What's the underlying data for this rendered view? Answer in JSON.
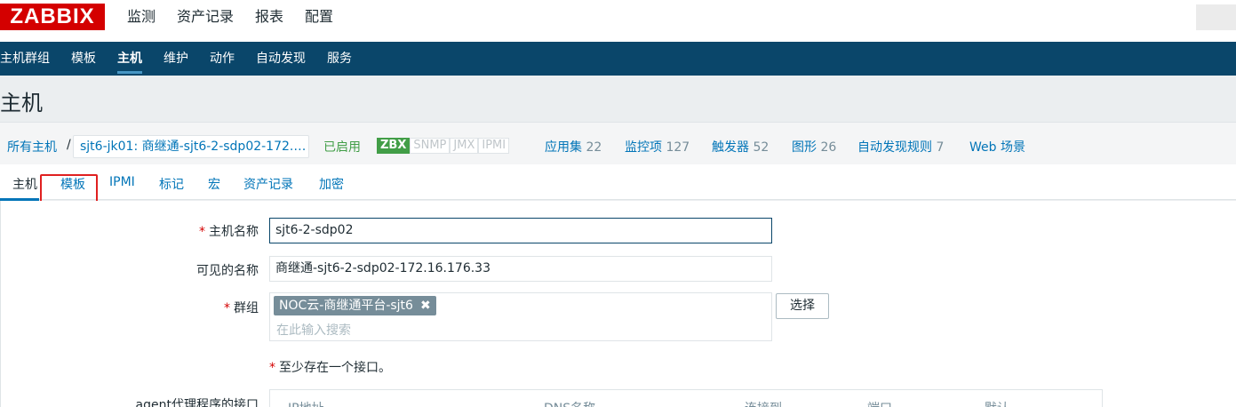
{
  "header": {
    "logo": "ZABBIX",
    "menu": [
      "监测",
      "资产记录",
      "报表",
      "配置"
    ]
  },
  "subnav": [
    "主机群组",
    "模板",
    "主机",
    "维护",
    "动作",
    "自动发现",
    "服务"
  ],
  "page_title": "主机",
  "breadcrumb": {
    "all_hosts": "所有主机",
    "separator": "/",
    "host": "sjt6-jk01: 商继通-sjt6-2-sdp02-172.…",
    "enabled": "已启用",
    "availability": [
      "ZBX",
      "SNMP",
      "JMX",
      "IPMI"
    ],
    "links": [
      {
        "label": "应用集",
        "count": "22"
      },
      {
        "label": "监控项",
        "count": "127"
      },
      {
        "label": "触发器",
        "count": "52"
      },
      {
        "label": "图形",
        "count": "26"
      },
      {
        "label": "自动发现规则",
        "count": "7"
      },
      {
        "label": "Web 场景",
        "count": ""
      }
    ]
  },
  "tabs": [
    "主机",
    "模板",
    "IPMI",
    "标记",
    "宏",
    "资产记录",
    "加密"
  ],
  "form": {
    "required_mark": "*",
    "host_name_label": "主机名称",
    "host_name_value": "sjt6-2-sdp02",
    "visible_name_label": "可见的名称",
    "visible_name_value": "商继通-sjt6-2-sdp02-172.16.176.33",
    "groups_label": "群组",
    "group_chip": "NOC云-商继通平台-sjt6",
    "chip_remove": "✖",
    "groups_placeholder": "在此输入搜索",
    "select_button": "选择",
    "interface_note": "至少存在一个接口。",
    "agent_interfaces_label": "agent代理程序的接口",
    "interface_columns": [
      "IP地址",
      "DNS名称",
      "连接到",
      "端口",
      "默认"
    ]
  },
  "colors": {
    "brand_red": "#d40000",
    "nav_blue": "#0a466a",
    "link_blue": "#0275b8",
    "enabled_green": "#429e47",
    "highlight_red": "#e02020"
  }
}
